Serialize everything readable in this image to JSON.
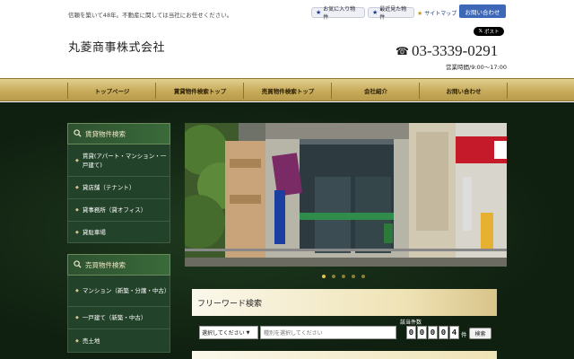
{
  "header": {
    "tagline": "信頼を築いて48年。不動産に関しては当社にお任せください。",
    "favorites": "お気に入り物件",
    "recent": "最近見た物件",
    "sitemap": "サイトマップ",
    "contact": "お問い合わせ",
    "x_post": "ポスト",
    "company_name": "丸菱商事株式会社",
    "phone": "03-3339-0291",
    "hours": "営業時間/9:00〜17:00"
  },
  "nav": [
    {
      "label": "トップページ"
    },
    {
      "label": "賃貸物件検索トップ"
    },
    {
      "label": "売買物件検索トップ"
    },
    {
      "label": "会社紹介"
    },
    {
      "label": "お問い合わせ"
    }
  ],
  "sidebar": {
    "rental": {
      "title": "賃貸物件検索",
      "items": [
        {
          "label": "賃貸(アパート・マンション・一戸建て)"
        },
        {
          "label": "貸店舗（テナント）"
        },
        {
          "label": "貸事務所（貸オフィス）"
        },
        {
          "label": "貸駐車場"
        }
      ]
    },
    "sale": {
      "title": "売買物件検索",
      "items": [
        {
          "label": "マンション（新築・分譲・中古）"
        },
        {
          "label": "一戸建て（新築・中古）"
        },
        {
          "label": "売土地"
        }
      ]
    }
  },
  "slider": {
    "dot_count": 5,
    "active_index": 0
  },
  "freeword": {
    "title": "フリーワード検索",
    "select_value": "選択してください",
    "input_placeholder": "種別を選択してください",
    "count_label": "該当件数",
    "digits": [
      "0",
      "0",
      "0",
      "0",
      "4"
    ],
    "unit": "件",
    "search_button": "検索"
  },
  "colors": {
    "nav_gold": "#c8ac5c",
    "body_green": "#1f3a1e",
    "contact_blue": "#3d68b8"
  }
}
